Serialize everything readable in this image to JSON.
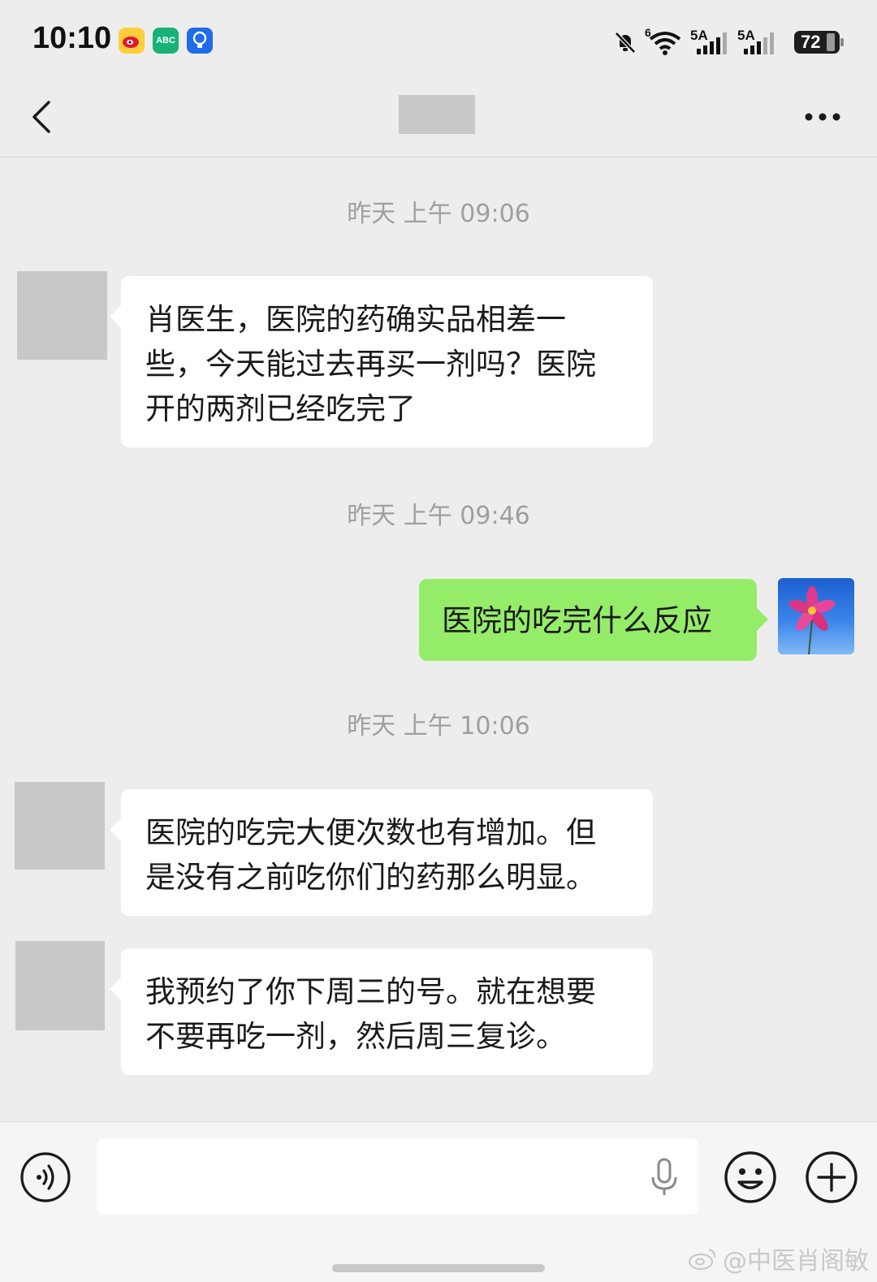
{
  "status_bar": {
    "time": "10:10",
    "network_1": "5A",
    "network_2": "5A",
    "wifi_label": "6",
    "battery": "72",
    "app_icons": [
      "weibo-icon",
      "abc-icon",
      "bulb-icon"
    ]
  },
  "nav": {
    "back_icon": "chevron-left-icon",
    "more_icon": "more-dots-icon"
  },
  "messages": [
    {
      "type": "timestamp",
      "text": "昨天 上午 09:06"
    },
    {
      "type": "incoming",
      "lines": [
        "肖医生，医院的药确实品相差一",
        "些，今天能过去再买一剂吗？医院",
        "开的两剂已经吃完了"
      ]
    },
    {
      "type": "timestamp",
      "text": "昨天 上午 09:46"
    },
    {
      "type": "outgoing",
      "lines": [
        "医院的吃完什么反应"
      ]
    },
    {
      "type": "timestamp",
      "text": "昨天 上午 10:06"
    },
    {
      "type": "incoming",
      "lines": [
        "医院的吃完大便次数也有增加。但",
        "是没有之前吃你们的药那么明显。"
      ]
    },
    {
      "type": "incoming",
      "lines": [
        "我预约了你下周三的号。就在想要",
        "不要再吃一剂，然后周三复诊。"
      ]
    }
  ],
  "input_bar": {
    "input_value": "",
    "icons": [
      "voice-icon",
      "mic-icon",
      "emoji-icon",
      "plus-icon"
    ]
  },
  "watermark": {
    "text": "@中医肖阁敏"
  },
  "colors": {
    "background": "#ededed",
    "incoming_bubble": "#ffffff",
    "outgoing_bubble": "#95ec69",
    "timestamp": "#9f9f9f"
  }
}
